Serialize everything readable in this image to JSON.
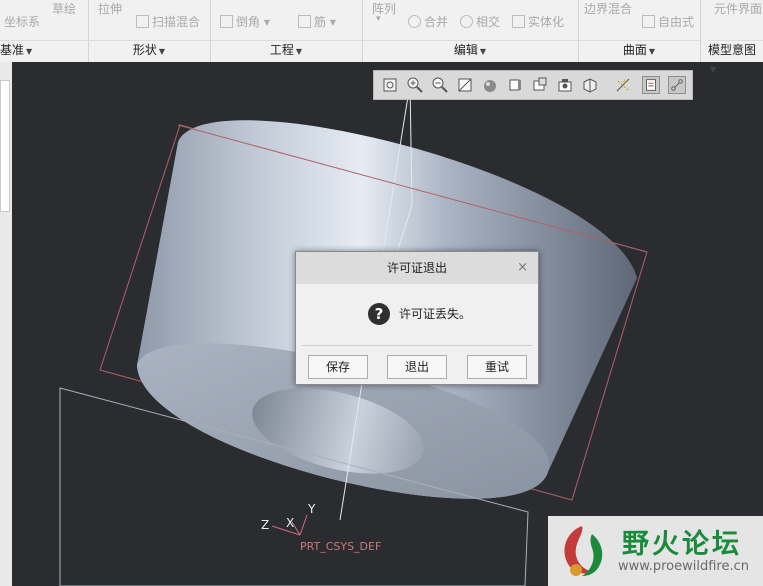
{
  "ribbon": {
    "commands": {
      "coordinate_system": "坐标系",
      "sketch": "草绘",
      "extrude": "拉伸",
      "swept_blend": "扫描混合",
      "chamfer": "倒角",
      "rib": "筋",
      "pattern": "阵列",
      "merge": "合并",
      "intersect": "相交",
      "solidify": "实体化",
      "boundary_blend": "边界混合",
      "freestyle": "自由式",
      "component_interface": "元件界面"
    },
    "groups": {
      "datum": "基准",
      "shapes": "形状",
      "engineering": "工程",
      "editing": "编辑",
      "surfaces": "曲面",
      "model_intent": "模型意图"
    }
  },
  "dialog": {
    "title": "许可证退出",
    "close": "×",
    "message": "许可证丢失。",
    "buttons": {
      "save": "保存",
      "exit": "退出",
      "retry": "重试"
    }
  },
  "csys": {
    "name": "PRT_CSYS_DEF",
    "z": "Z",
    "x": "X",
    "y": "Y"
  },
  "watermark": {
    "title": "野火论坛",
    "url": "www.proewildfire.cn"
  },
  "colors": {
    "viewport_bg": "#2b2c30",
    "model_surface": "#b8c2cf",
    "datum_plane": "#b0606a",
    "watermark_green": "#1c8a3c"
  }
}
